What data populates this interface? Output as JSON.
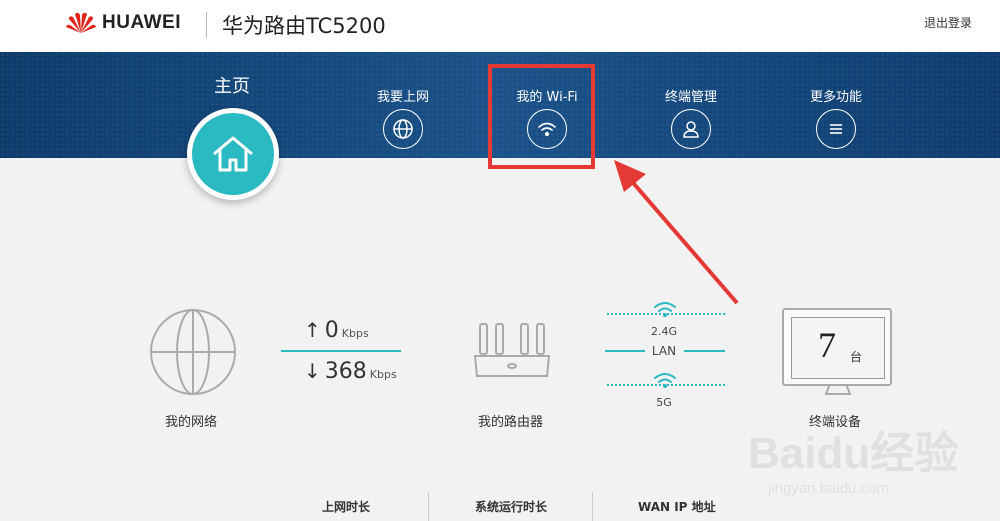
{
  "header": {
    "brand": "HUAWEI",
    "router_name": "华为路由TC5200",
    "logout": "退出登录"
  },
  "nav": {
    "home": "主页",
    "items": [
      {
        "label": "我要上网",
        "icon": "globe-icon"
      },
      {
        "label": "我的 Wi-Fi",
        "icon": "wifi-icon"
      },
      {
        "label": "终端管理",
        "icon": "user-icon"
      },
      {
        "label": "更多功能",
        "icon": "menu-icon"
      }
    ]
  },
  "status": {
    "network_label": "我的网络",
    "upload_value": "0",
    "upload_unit": "Kbps",
    "download_value": "368",
    "download_unit": "Kbps",
    "router_label": "我的路由器",
    "band_24": "2.4G",
    "band_lan": "LAN",
    "band_5": "5G",
    "device_count": "7",
    "device_unit": "台",
    "devices_label": "终端设备"
  },
  "bottom": {
    "online_time": "上网时长",
    "uptime": "系统运行时长",
    "wan_ip": "WAN IP 地址"
  },
  "watermark": {
    "line1": "Baidu经验",
    "line2": "jingyan.baidu.com"
  },
  "colors": {
    "accent": "#2bb9c2",
    "nav_bg": "#1a5289",
    "highlight": "#e53935",
    "brand_red": "#e2231a"
  }
}
